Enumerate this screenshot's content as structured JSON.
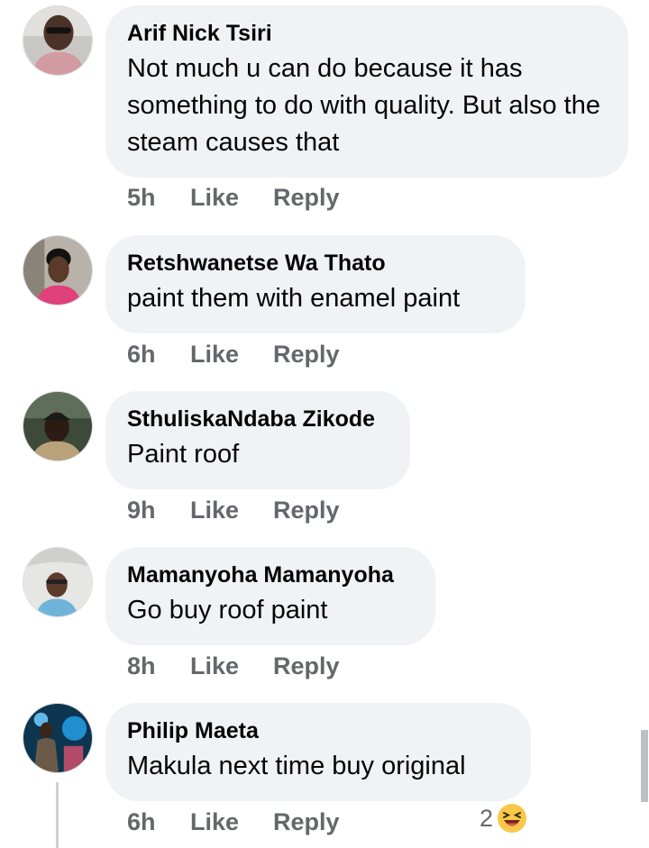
{
  "colors": {
    "bubble_bg": "#f0f2f5",
    "meta_text": "#65676b",
    "name_text": "#050505",
    "thread_line": "#ccd0d5"
  },
  "comments": [
    {
      "author": "Arif Nick Tsiri",
      "text": "Not much u can do because it has something to do with quality. But also the steam causes that",
      "time": "5h",
      "like": "Like",
      "reply": "Reply"
    },
    {
      "author": "Retshwanetse Wa Thato",
      "text": "paint them with enamel paint",
      "time": "6h",
      "like": "Like",
      "reply": "Reply"
    },
    {
      "author": "SthuliskaNdaba Zikode",
      "text": "Paint roof",
      "time": "9h",
      "like": "Like",
      "reply": "Reply"
    },
    {
      "author": "Mamanyoha Mamanyoha",
      "text": "Go buy roof paint",
      "time": "8h",
      "like": "Like",
      "reply": "Reply"
    },
    {
      "author": "Philip Maeta",
      "text": "Makula next time buy original",
      "time": "6h",
      "like": "Like",
      "reply": "Reply",
      "reaction_count": "2",
      "reaction_icon": "laughing-emoji-icon"
    }
  ]
}
